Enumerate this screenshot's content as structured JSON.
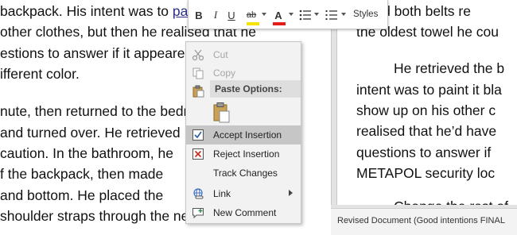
{
  "left_page": {
    "lines": [
      [
        {
          "t": "backpack. His intent was to "
        },
        {
          "t": "paint it black",
          "ins": true
        }
      ],
      [
        {
          "t": "other clothes, but then he realised that he"
        }
      ],
      [
        {
          "t": "estions to answer if it appeared"
        }
      ],
      [
        {
          "t": "ifferent color."
        }
      ],
      [
        {
          "t": "nute, then returned to the bedroom"
        }
      ],
      [
        {
          "t": "and turned over. He retrieved"
        }
      ],
      [
        {
          "t": "caution. In the bathroom, he"
        }
      ],
      [
        {
          "t": "f the backpack, then made"
        }
      ],
      [
        {
          "t": "and bottom. He placed the"
        }
      ],
      [
        {
          "t": "shoulder straps through the new holes"
        }
      ]
    ]
  },
  "right_page": {
    "lines": [
      "k and both belts re",
      "the oldest towel he cou",
      "He retrieved the b",
      "intent was to paint it bla",
      "show up on his other c",
      "realised that he’d have",
      "questions to answer if",
      "METAPOL security loc",
      "Change the rest of"
    ]
  },
  "status_bar": {
    "text": "Revised Document (Good intentions FINAL"
  },
  "mini_toolbar": {
    "bold": "B",
    "italic": "I",
    "underline": "U",
    "highlight": "ab",
    "font_color": "A",
    "styles_label": "Styles",
    "highlight_color": "#f5e400",
    "font_color_bar": "#e51c1c"
  },
  "context_menu": {
    "cut": "Cut",
    "copy": "Copy",
    "paste_options": "Paste Options:",
    "accept_insertion": "Accept Insertion",
    "reject_insertion": "Reject Insertion",
    "track_changes": "Track Changes",
    "link": "Link",
    "new_comment": "New Comment"
  }
}
